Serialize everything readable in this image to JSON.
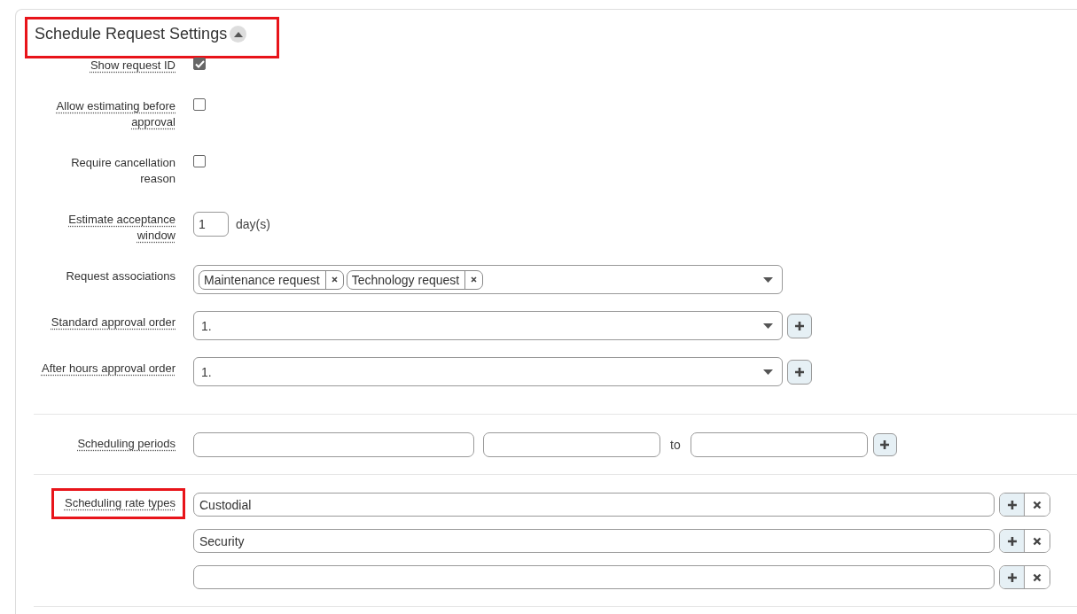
{
  "header": {
    "title": "Schedule Request Settings",
    "highlighted": true,
    "expanded": true
  },
  "groups": [
    {
      "fields": [
        {
          "kind": "checkbox",
          "label": "Show request ID",
          "has_tooltip": true,
          "checked": true,
          "highlighted": false
        },
        {
          "kind": "checkbox",
          "label": "Allow estimating before approval",
          "has_tooltip": true,
          "checked": false,
          "highlighted": false
        },
        {
          "kind": "checkbox",
          "label": "Require cancellation reason",
          "has_tooltip": false,
          "checked": false,
          "highlighted": false
        },
        {
          "kind": "number",
          "label": "Estimate acceptance window",
          "has_tooltip": true,
          "value": "1",
          "unit": "day(s)",
          "highlighted": false
        },
        {
          "kind": "tags",
          "label": "Request associations",
          "has_tooltip": false,
          "tags": [
            "Maintenance request",
            "Technology request"
          ],
          "highlighted": false
        },
        {
          "kind": "select",
          "label": "Standard approval order",
          "has_tooltip": true,
          "value": "1.",
          "highlighted": false
        },
        {
          "kind": "select",
          "label": "After hours approval order",
          "has_tooltip": true,
          "value": "1.",
          "highlighted": false
        }
      ]
    },
    {
      "fields": [
        {
          "kind": "range",
          "label": "Scheduling periods",
          "has_tooltip": true,
          "joiner": "to",
          "highlighted": false
        }
      ]
    },
    {
      "fields": [
        {
          "kind": "list",
          "label": "Scheduling rate types",
          "has_tooltip": true,
          "rows": [
            {
              "value": "Custodial"
            },
            {
              "value": "Security"
            },
            {}
          ],
          "highlighted": true
        }
      ]
    }
  ]
}
